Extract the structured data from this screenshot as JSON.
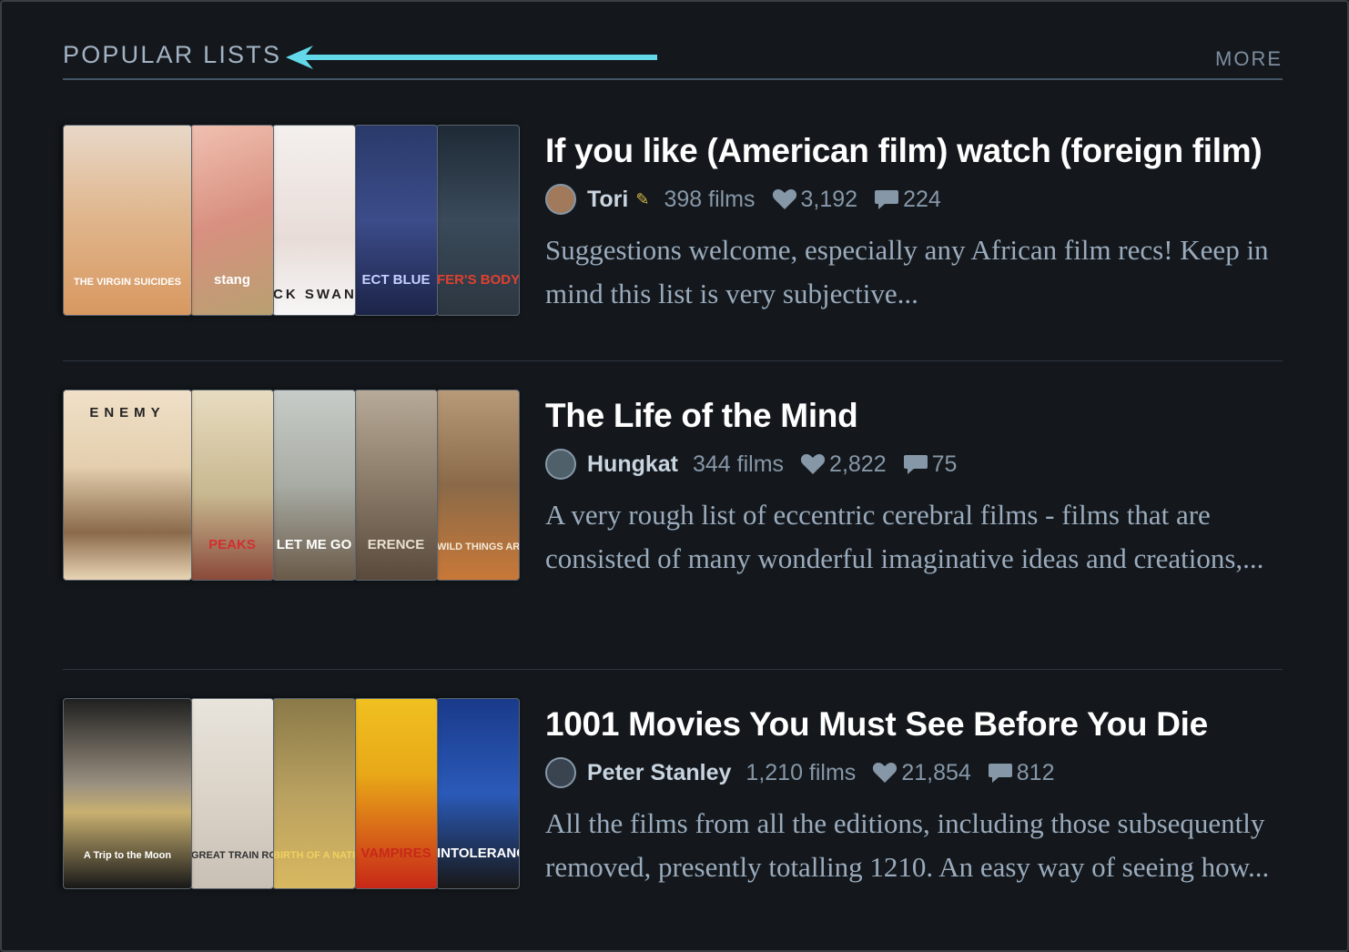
{
  "section": {
    "title": "POPULAR LISTS",
    "more_label": "MORE",
    "arrow_color": "#62d8e8"
  },
  "lists": [
    {
      "title": "If you like (American film) watch (foreign film)",
      "author": "Tori",
      "badge_icon": "patron-badge-icon",
      "films": "398 films",
      "likes": "3,192",
      "comments": "224",
      "description": "Suggestions welcome, especially any African film recs! Keep in mind this list is very subjective...",
      "posters": [
        {
          "text": "THE VIRGIN SUICIDES",
          "bg": "linear-gradient(180deg,#e8d8c8 0%,#e0b890 45%,#d89860 100%)",
          "color": "#ffffff"
        },
        {
          "text": "stang",
          "bg": "linear-gradient(160deg,#f0c0b0 0%,#d89080 50%,#b8a070 100%)",
          "color": "#ffffff"
        },
        {
          "text": "CK SWAN",
          "bg": "linear-gradient(180deg,#f4f0ee 0%,#e8dcd8 60%,#f6f6f6 100%)",
          "color": "#222222"
        },
        {
          "text": "ECT BLUE",
          "bg": "linear-gradient(180deg,#2a3a6a 0%,#3c4c8a 50%,#1c2448 100%)",
          "color": "#c8d0ff"
        },
        {
          "text": "FER'S BODY",
          "bg": "linear-gradient(180deg,#1e2a36 0%,#3a4a5a 50%,#2c3640 100%)",
          "color": "#e04030"
        }
      ]
    },
    {
      "title": "The Life of the Mind",
      "author": "Hungkat",
      "badge_icon": "",
      "films": "344 films",
      "likes": "2,822",
      "comments": "75",
      "description": "A very rough list of eccentric cerebral films - films that are consisted of many wonderful imaginative ideas and creations,...",
      "posters": [
        {
          "text": "ENEMY",
          "bg": "linear-gradient(180deg,#f0e0c8 0%,#e4cfae 40%,#8a6a4a 75%,#e8d4b4 100%)",
          "color": "#222222"
        },
        {
          "text": "PEAKS",
          "bg": "linear-gradient(180deg,#e8dcc0 0%,#c8b890 55%,#8a4a3a 100%)",
          "color": "#d03030"
        },
        {
          "text": "LET ME GO",
          "bg": "linear-gradient(180deg,#c8ccc8 0%,#a8aca4 50%,#6a5a48 100%)",
          "color": "#ffffff"
        },
        {
          "text": "ERENCE",
          "bg": "linear-gradient(180deg,#b8aa98 0%,#8a7a68 50%,#5a4a3c 100%)",
          "color": "#e8e0d0"
        },
        {
          "text": "WILD THINGS ARE",
          "bg": "linear-gradient(180deg,#b89a78 0%,#8a6a48 50%,#c87838 100%)",
          "color": "#f4ead8"
        }
      ]
    },
    {
      "title": "1001 Movies You Must See Before You Die",
      "author": "Peter Stanley",
      "badge_icon": "",
      "films": "1,210 films",
      "likes": "21,854",
      "comments": "812",
      "description": "All the films from all the editions, including those subsequently removed, presently totalling 1210. An easy way of seeing how...",
      "posters": [
        {
          "text": "A Trip to the Moon",
          "bg": "linear-gradient(180deg,#202020 0%,#9a9080 45%,#c8b070 60%,#181818 100%)",
          "color": "#ffffff"
        },
        {
          "text": "GREAT TRAIN ROBBERY",
          "bg": "linear-gradient(180deg,#e8e4dc 0%,#d8d0c4 60%,#c8c0b4 100%)",
          "color": "#333333"
        },
        {
          "text": "BIRTH OF A NATION",
          "bg": "linear-gradient(180deg,#8a7a48 0%,#b8a060 50%,#d8b860 100%)",
          "color": "#f0d060"
        },
        {
          "text": "VAMPIRES",
          "bg": "linear-gradient(180deg,#f0c020 0%,#e8a818 40%,#c82818 100%)",
          "color": "#c82818"
        },
        {
          "text": "INTOLERANCE",
          "bg": "linear-gradient(180deg,#1a3a8a 0%,#2a5ab8 50%,#181818 100%)",
          "color": "#ffffff"
        }
      ]
    }
  ]
}
